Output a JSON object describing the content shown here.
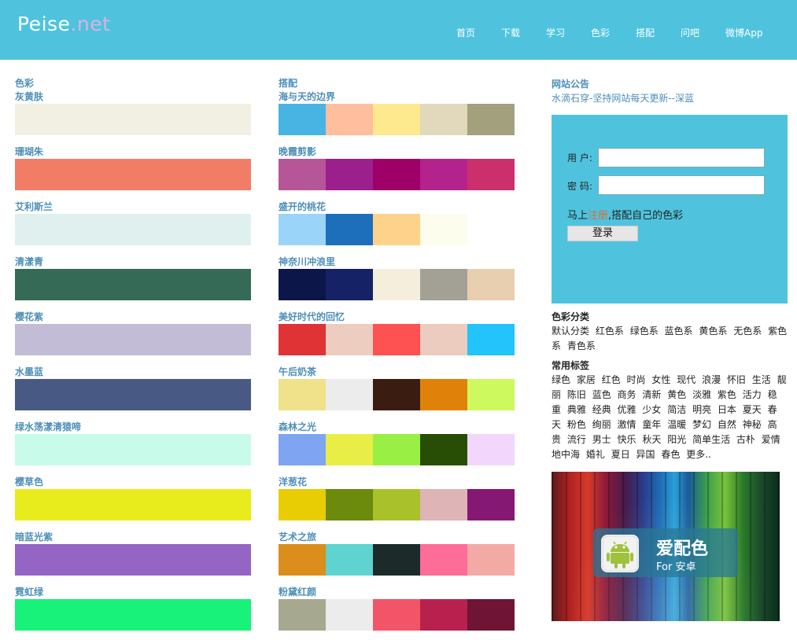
{
  "header": {
    "logo_main": "Peise",
    "logo_tld": ".net",
    "nav": [
      "首页",
      "下载",
      "学习",
      "色彩",
      "搭配",
      "问吧",
      "微博App"
    ]
  },
  "colors_section": {
    "title": "色彩",
    "items": [
      {
        "name": "灰黄肤",
        "color": "#f2efe3"
      },
      {
        "name": "珊瑚朱",
        "color": "#f27d67"
      },
      {
        "name": "艾利斯兰",
        "color": "#dff0ee"
      },
      {
        "name": "清漾青",
        "color": "#356a56"
      },
      {
        "name": "樱花紫",
        "color": "#c2bcd6"
      },
      {
        "name": "水墨蓝",
        "color": "#485a84"
      },
      {
        "name": "绿水荡漾清猿啼",
        "color": "#c8fbea"
      },
      {
        "name": "樱草色",
        "color": "#e9ec1c"
      },
      {
        "name": "暗蓝光紫",
        "color": "#9565c6"
      },
      {
        "name": "霓虹绿",
        "color": "#18f27a"
      }
    ]
  },
  "palettes_section": {
    "title": "搭配",
    "items": [
      {
        "name": "海与天的边界",
        "colors": [
          "#47b4e4",
          "#ffbe9e",
          "#fde98e",
          "#e2d8bb",
          "#a3a07e"
        ]
      },
      {
        "name": "晚霞剪影",
        "colors": [
          "#b65698",
          "#9c1f8e",
          "#9e0068",
          "#b4228d",
          "#cb2f6c"
        ]
      },
      {
        "name": "盛开的桃花",
        "colors": [
          "#9ad4f9",
          "#1e6fbb",
          "#fdd38c",
          "#fcfdec",
          "#ffffff"
        ]
      },
      {
        "name": "神奈川冲浪里",
        "colors": [
          "#0d1649",
          "#162266",
          "#f6eedd",
          "#a3a095",
          "#e8cfaf"
        ]
      },
      {
        "name": "美好时代的回忆",
        "colors": [
          "#e03336",
          "#eccdbf",
          "#fe5252",
          "#ecccbf",
          "#22c4fb"
        ]
      },
      {
        "name": "午后奶茶",
        "colors": [
          "#efe28a",
          "#ececec",
          "#3b1c10",
          "#e0820a",
          "#cdf95e"
        ]
      },
      {
        "name": "森林之光",
        "colors": [
          "#7fa4f2",
          "#e8ee46",
          "#9aef45",
          "#284d04",
          "#f3d6fc"
        ]
      },
      {
        "name": "洋葱花",
        "colors": [
          "#e8cd05",
          "#6c8a0b",
          "#a9c12b",
          "#deb4b7",
          "#851873"
        ]
      },
      {
        "name": "艺术之旅",
        "colors": [
          "#db8e1b",
          "#5ed3d0",
          "#1c2b29",
          "#fe6c98",
          "#f3aaa5"
        ]
      },
      {
        "name": "粉黛红颜",
        "colors": [
          "#a7a890",
          "#ececec",
          "#f25468",
          "#b8214e",
          "#6f1435"
        ]
      }
    ]
  },
  "sidebar": {
    "notice_title": "网站公告",
    "notice_text": "水滴石穿-坚持网站每天更新--深蓝",
    "login": {
      "user_label": "用 户:",
      "pass_label": "密 码:",
      "user_value": "",
      "pass_value": "",
      "reg_prefix": "马上",
      "reg_link": "注册",
      "reg_suffix": ",搭配自己的色彩",
      "login_button": "登录"
    },
    "category_title": "色彩分类",
    "categories": [
      "默认分类",
      "红色系",
      "绿色系",
      "蓝色系",
      "黄色系",
      "无色系",
      "紫色系",
      "青色系"
    ],
    "tags_title": "常用标签",
    "tags": [
      "绿色",
      "家居",
      "红色",
      "时尚",
      "女性",
      "现代",
      "浪漫",
      "怀旧",
      "生活",
      "靓丽",
      "陈旧",
      "蓝色",
      "商务",
      "清新",
      "黄色",
      "淡雅",
      "紫色",
      "活力",
      "稳重",
      "典雅",
      "经典",
      "优雅",
      "少女",
      "简洁",
      "明亮",
      "日本",
      "夏天",
      "春天",
      "粉色",
      "绚丽",
      "激情",
      "童年",
      "温暖",
      "梦幻",
      "自然",
      "神秘",
      "高贵",
      "流行",
      "男士",
      "快乐",
      "秋天",
      "阳光",
      "简单生活",
      "古朴",
      "爱情",
      "地中海",
      "婚礼",
      "夏日",
      "异国",
      "春色",
      "更多.."
    ],
    "app_banner": {
      "title": "爱配色",
      "subtitle": "For 安卓"
    }
  }
}
